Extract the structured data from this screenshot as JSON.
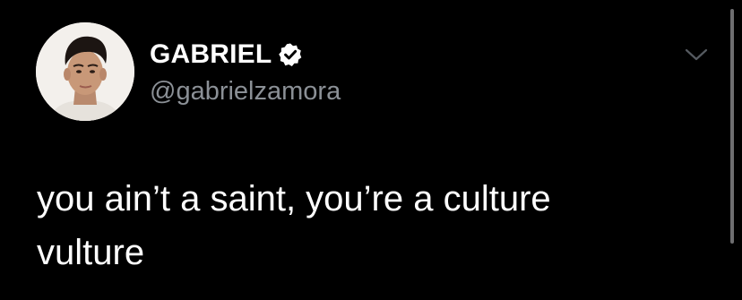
{
  "tweet": {
    "author": {
      "display_name": "GABRIEL",
      "handle": "@gabrielzamora",
      "verified": true
    },
    "text": "you ain’t a saint, you’re a culture\nvulture"
  },
  "icons": {
    "verified": "verified-badge-icon",
    "more": "chevron-down-icon"
  },
  "colors": {
    "background": "#000000",
    "text": "#ffffff",
    "handle": "#8b9096",
    "chevron": "#555a60",
    "scrollbar": "#6e6e70"
  }
}
